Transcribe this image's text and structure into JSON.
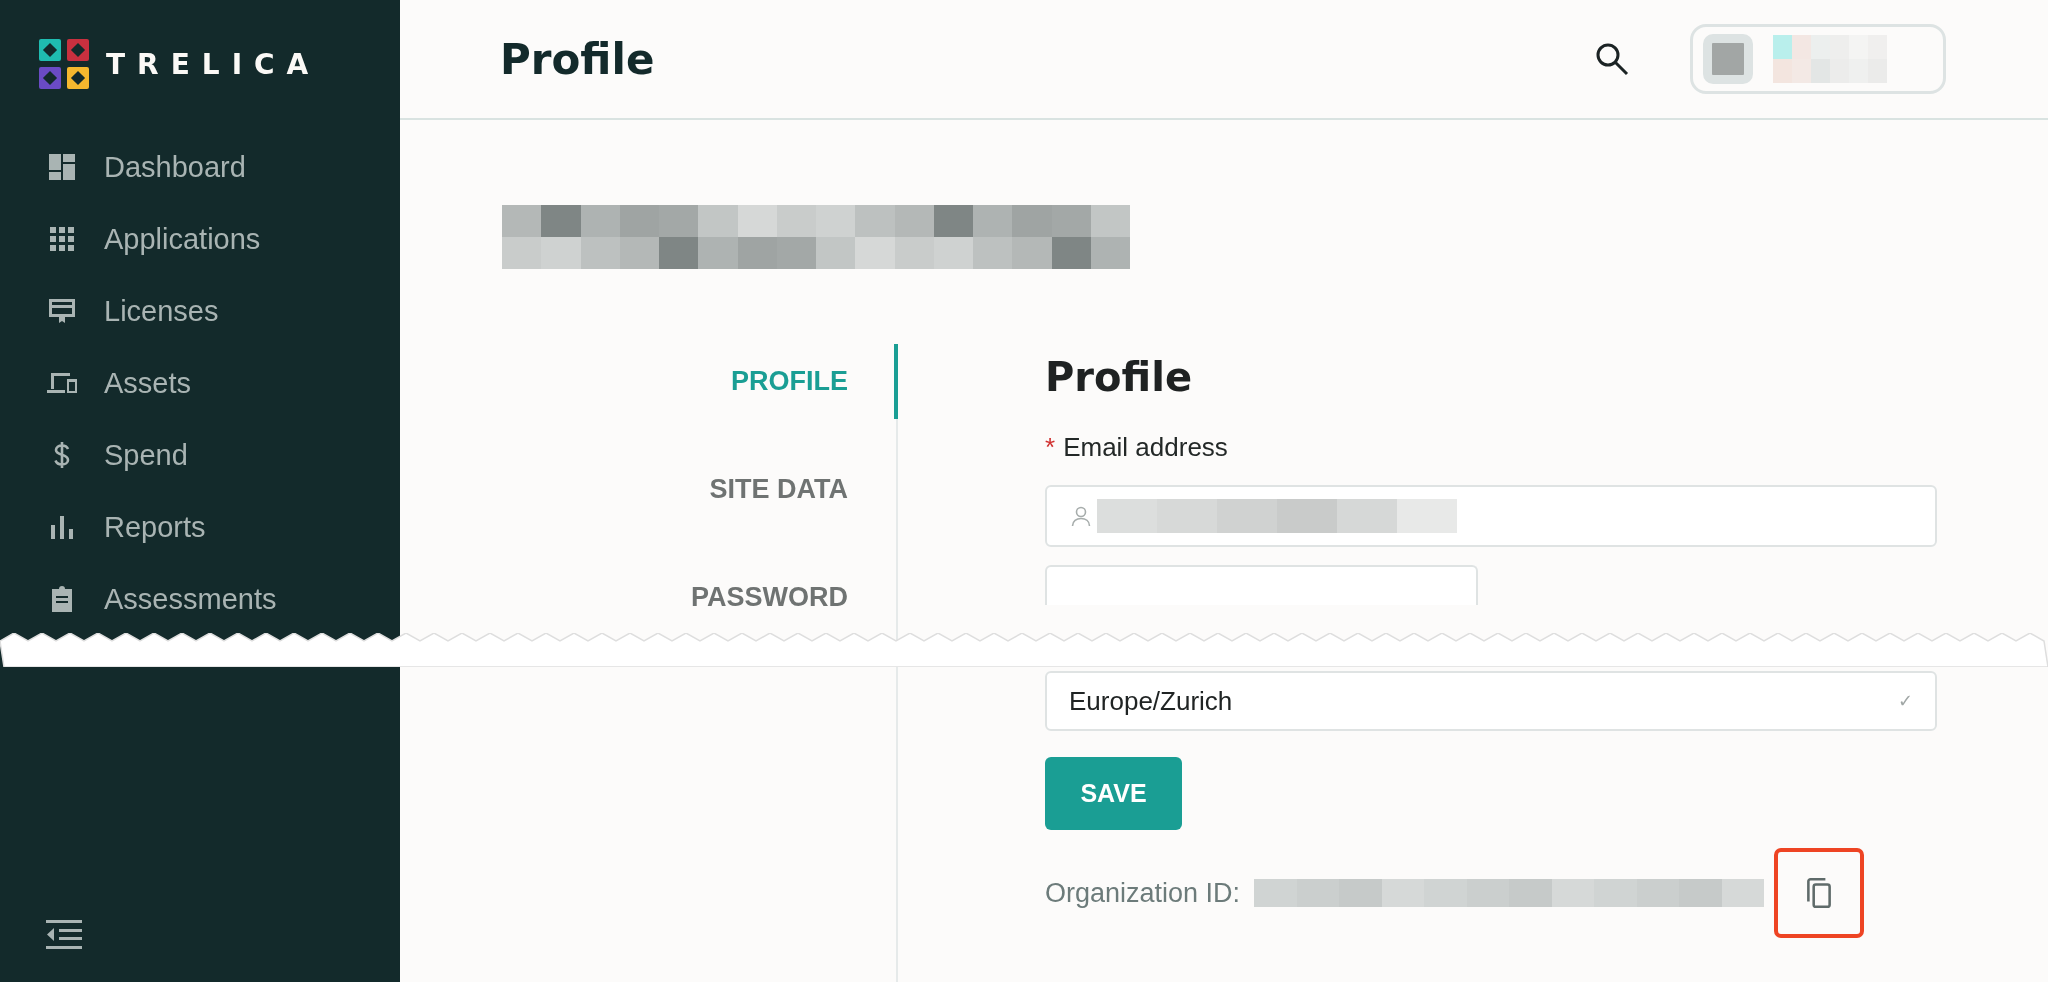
{
  "sidebar": {
    "logo": "TRELICA",
    "items": [
      {
        "label": "Dashboard",
        "kind": "dashboard"
      },
      {
        "label": "Applications",
        "kind": "grid"
      },
      {
        "label": "Licenses",
        "kind": "license"
      },
      {
        "label": "Assets",
        "kind": "devices"
      },
      {
        "label": "Spend",
        "kind": "dollar"
      },
      {
        "label": "Reports",
        "kind": "bars"
      },
      {
        "label": "Assessments",
        "kind": "clipboard"
      }
    ]
  },
  "header": {
    "title": "Profile"
  },
  "tabs": [
    {
      "label": "PROFILE",
      "selected": true
    },
    {
      "label": "SITE DATA",
      "selected": false
    },
    {
      "label": "PASSWORD",
      "selected": false
    }
  ],
  "form": {
    "heading": "Profile",
    "email": {
      "required_mark": "*",
      "label": "Email address"
    },
    "timezone": {
      "value": "Europe/Zurich",
      "indicator": "✓"
    },
    "save": "SAVE",
    "org_id": {
      "label": "Organization ID:"
    }
  }
}
